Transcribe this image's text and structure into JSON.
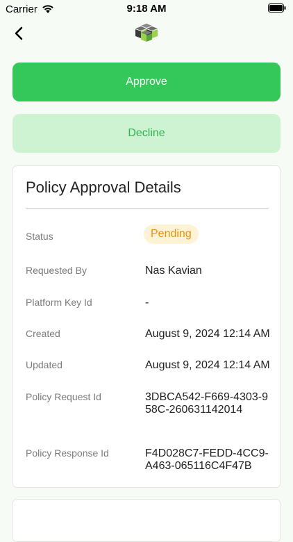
{
  "status_bar": {
    "carrier": "Carrier",
    "time": "9:18 AM"
  },
  "actions": {
    "approve_label": "Approve",
    "decline_label": "Decline"
  },
  "details": {
    "title": "Policy Approval Details",
    "rows": [
      {
        "label": "Status",
        "value": "Pending"
      },
      {
        "label": "Requested By",
        "value": "Nas Kavian"
      },
      {
        "label": "Platform Key Id",
        "value": "-"
      },
      {
        "label": "Created",
        "value": "August 9, 2024 12:14 AM"
      },
      {
        "label": "Updated",
        "value": "August 9, 2024 12:14 AM"
      },
      {
        "label": "Policy Request Id",
        "value": "3DBCA542-F669-4303-958C-260631142014"
      },
      {
        "label": "Policy Response Id",
        "value": "F4D028C7-FEDD-4CC9-A463-065116C4F47B"
      }
    ]
  },
  "colors": {
    "approve": "#34c759",
    "decline_bg": "#cdf3d3",
    "pending_text": "#e8900c",
    "pending_bg": "#fff3d6"
  },
  "icons": {
    "back": "chevron-left-icon",
    "logo": "cubes-logo-icon",
    "wifi": "wifi-icon",
    "battery": "battery-icon"
  }
}
